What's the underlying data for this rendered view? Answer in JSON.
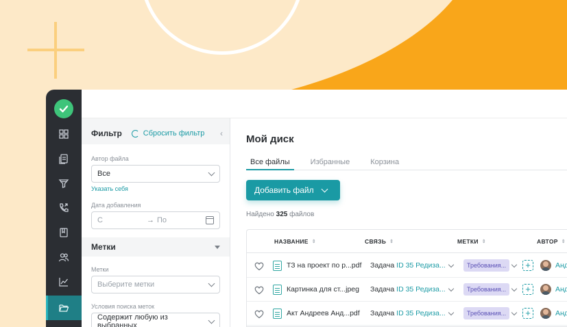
{
  "colors": {
    "accent": "#1a9aa4",
    "rail": "#2b2e33",
    "background": "#fde9c8",
    "orange": "#f9a61a",
    "tag_bg": "#dcd9f4"
  },
  "rail": {
    "logo_icon": "check-circle-icon",
    "items": [
      {
        "icon": "grid-icon"
      },
      {
        "icon": "documents-icon"
      },
      {
        "icon": "funnel-icon"
      },
      {
        "icon": "phone-icon"
      },
      {
        "icon": "book-icon"
      },
      {
        "icon": "users-icon"
      },
      {
        "icon": "chart-icon"
      },
      {
        "icon": "folder-icon",
        "active": true
      }
    ]
  },
  "filter": {
    "title": "Фильтр",
    "reset": "Сбросить фильтр",
    "author_label": "Автор файла",
    "author_value": "Все",
    "self_link": "Указать себя",
    "date_label": "Дата добавления",
    "date_from": "С",
    "date_to": "По",
    "tags_section": "Метки",
    "tags_label": "Метки",
    "tags_placeholder": "Выберите метки",
    "search_label": "Условия поиска меток",
    "search_value": "Содержит любую из выбранных"
  },
  "main": {
    "title": "Мой диск",
    "tabs": [
      "Все файлы",
      "Избранные",
      "Корзина"
    ],
    "add_button": "Добавить файл",
    "found_prefix": "Найдено",
    "found_count": "325",
    "found_suffix": "файлов",
    "columns": [
      "НАЗВАНИЕ",
      "СВЯЗЬ",
      "МЕТКИ",
      "АВТОР"
    ],
    "rows": [
      {
        "name": "ТЗ на проект по p...pdf",
        "link_type": "Задача",
        "link_id": "ID 35 Редиза...",
        "tag": "Требования...",
        "author": "Анд"
      },
      {
        "name": "Картинка для ст...jpeg",
        "link_type": "Задача",
        "link_id": "ID 35 Редиза...",
        "tag": "Требования...",
        "author": "Анд"
      },
      {
        "name": "Акт Андреев Анд...pdf",
        "link_type": "Задача",
        "link_id": "ID 35 Редиза...",
        "tag": "Требования...",
        "author": "Анд"
      }
    ]
  }
}
